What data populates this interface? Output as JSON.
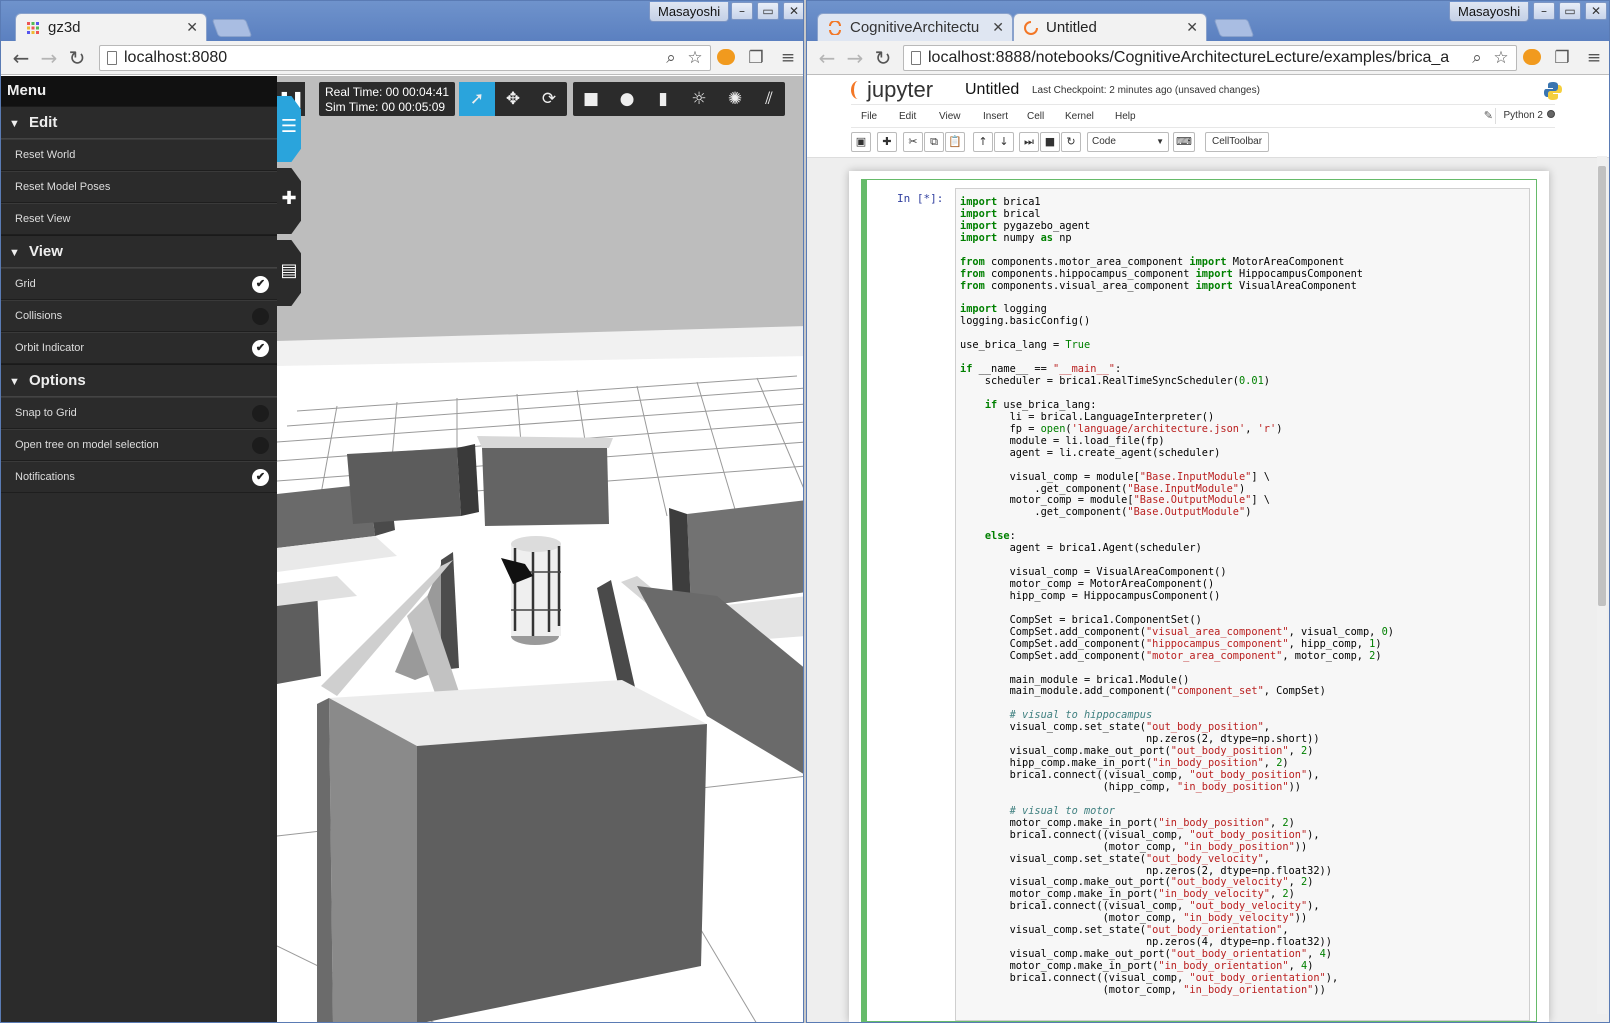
{
  "left_window": {
    "tab_title": "gz3d",
    "profile": "Masayoshi",
    "url": "localhost:8080",
    "menu": {
      "title": "Menu",
      "sections": [
        {
          "label": "Edit",
          "items": [
            {
              "label": "Reset World"
            },
            {
              "label": "Reset Model Poses"
            },
            {
              "label": "Reset View"
            }
          ]
        },
        {
          "label": "View",
          "items": [
            {
              "label": "Grid",
              "toggle": true
            },
            {
              "label": "Collisions",
              "toggle": false
            },
            {
              "label": "Orbit Indicator",
              "toggle": true
            }
          ]
        },
        {
          "label": "Options",
          "items": [
            {
              "label": "Snap to Grid",
              "toggle": false
            },
            {
              "label": "Open tree on model selection",
              "toggle": false
            },
            {
              "label": "Notifications",
              "toggle": true
            }
          ]
        }
      ]
    },
    "real_time": "Real Time: 00 00:04:41",
    "sim_time": "Sim Time: 00 00:05:09",
    "toolbar_icons": [
      "select-arrow-icon",
      "translate-icon",
      "rotate-icon",
      "box-icon",
      "sphere-icon",
      "cylinder-icon",
      "point-light-icon",
      "spot-light-icon",
      "directional-light-icon"
    ],
    "colors": {
      "accent": "#2aa4dc",
      "panel": "#2b2b2b"
    }
  },
  "right_window": {
    "tabs": [
      {
        "title": "CognitiveArchitectu",
        "active": false
      },
      {
        "title": "Untitled",
        "active": true
      }
    ],
    "profile": "Masayoshi",
    "url": "localhost:8888/notebooks/CognitiveArchitectureLecture/examples/brica_a",
    "jupyter": {
      "logo": "jupyter",
      "notebook_name": "Untitled",
      "checkpoint": "Last Checkpoint: 2 minutes ago (unsaved changes)",
      "menus": [
        "File",
        "Edit",
        "View",
        "Insert",
        "Cell",
        "Kernel",
        "Help"
      ],
      "kernel": "Python 2",
      "cell_type": "Code",
      "celltoolbar": "CellToolbar",
      "prompt": "In [*]:",
      "code_lines": [
        "import brica1",
        "import brical",
        "import pygazebo_agent",
        "import numpy as np",
        "",
        "from components.motor_area_component import MotorAreaComponent",
        "from components.hippocampus_component import HippocampusComponent",
        "from components.visual_area_component import VisualAreaComponent",
        "",
        "import logging",
        "logging.basicConfig()",
        "",
        "use_brica_lang = True",
        "",
        "if __name__ == \"__main__\":",
        "    scheduler = brica1.RealTimeSyncScheduler(0.01)",
        "",
        "    if use_brica_lang:",
        "        li = brical.LanguageInterpreter()",
        "        fp = open('language/architecture.json', 'r')",
        "        module = li.load_file(fp)",
        "        agent = li.create_agent(scheduler)",
        "",
        "        visual_comp = module[\"Base.InputModule\"] \\",
        "            .get_component(\"Base.InputModule\")",
        "        motor_comp = module[\"Base.OutputModule\"] \\",
        "            .get_component(\"Base.OutputModule\")",
        "",
        "    else:",
        "        agent = brica1.Agent(scheduler)",
        "",
        "        visual_comp = VisualAreaComponent()",
        "        motor_comp = MotorAreaComponent()",
        "        hipp_comp = HippocampusComponent()",
        "",
        "        CompSet = brica1.ComponentSet()",
        "        CompSet.add_component(\"visual_area_component\", visual_comp, 0)",
        "        CompSet.add_component(\"hippocampus_component\", hipp_comp, 1)",
        "        CompSet.add_component(\"motor_area_component\", motor_comp, 2)",
        "",
        "        main_module = brica1.Module()",
        "        main_module.add_component(\"component_set\", CompSet)",
        "",
        "        # visual to hippocampus",
        "        visual_comp.set_state(\"out_body_position\",",
        "                              np.zeros(2, dtype=np.short))",
        "        visual_comp.make_out_port(\"out_body_position\", 2)",
        "        hipp_comp.make_in_port(\"in_body_position\", 2)",
        "        brica1.connect((visual_comp, \"out_body_position\"),",
        "                       (hipp_comp, \"in_body_position\"))",
        "",
        "        # visual to motor",
        "        motor_comp.make_in_port(\"in_body_position\", 2)",
        "        brica1.connect((visual_comp, \"out_body_position\"),",
        "                       (motor_comp, \"in_body_position\"))",
        "        visual_comp.set_state(\"out_body_velocity\",",
        "                              np.zeros(2, dtype=np.float32))",
        "        visual_comp.make_out_port(\"out_body_velocity\", 2)",
        "        motor_comp.make_in_port(\"in_body_velocity\", 2)",
        "        brica1.connect((visual_comp, \"out_body_velocity\"),",
        "                       (motor_comp, \"in_body_velocity\"))",
        "        visual_comp.set_state(\"out_body_orientation\",",
        "                              np.zeros(4, dtype=np.float32))",
        "        visual_comp.make_out_port(\"out_body_orientation\", 4)",
        "        motor_comp.make_in_port(\"in_body_orientation\", 4)",
        "        brica1.connect((visual_comp, \"out_body_orientation\"),",
        "                       (motor_comp, \"in_body_orientation\"))"
      ]
    }
  }
}
